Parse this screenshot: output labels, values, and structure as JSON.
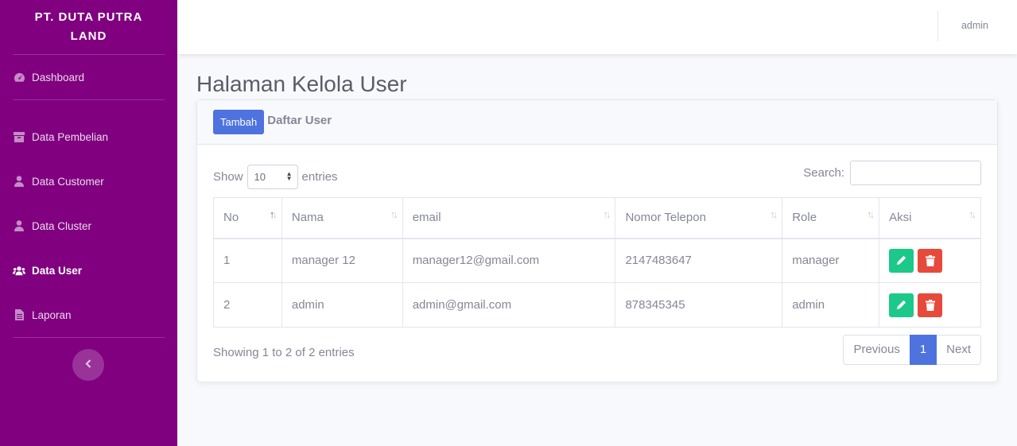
{
  "sidebar": {
    "brand": "PT. DUTA PUTRA LAND",
    "items": [
      {
        "label": "Dashboard",
        "icon": "tachometer-icon"
      },
      {
        "label": "Data Pembelian",
        "icon": "box-icon"
      },
      {
        "label": "Data Customer",
        "icon": "user-icon"
      },
      {
        "label": "Data Cluster",
        "icon": "user-icon"
      },
      {
        "label": "Data User",
        "icon": "users-icon",
        "active": true
      },
      {
        "label": "Laporan",
        "icon": "file-icon"
      }
    ]
  },
  "topbar": {
    "user": "admin"
  },
  "page": {
    "title": "Halaman Kelola User"
  },
  "card": {
    "add_label": "Tambah",
    "title": "Daftar User"
  },
  "controls": {
    "show_label": "Show",
    "entries_value": "10",
    "entries_label": "entries",
    "search_label": "Search:"
  },
  "table": {
    "headers": [
      "No",
      "Nama",
      "email",
      "Nomor Telepon",
      "Role",
      "Aksi"
    ],
    "rows": [
      {
        "no": "1",
        "nama": "manager 12",
        "email": "manager12@gmail.com",
        "telepon": "2147483647",
        "role": "manager"
      },
      {
        "no": "2",
        "nama": "admin",
        "email": "admin@gmail.com",
        "telepon": "878345345",
        "role": "admin"
      }
    ]
  },
  "footer": {
    "info": "Showing 1 to 2 of 2 entries",
    "prev": "Previous",
    "page": "1",
    "next": "Next"
  },
  "colors": {
    "sidebar": "#800080",
    "primary": "#4e73df",
    "success": "#1cc88a",
    "danger": "#e74a3b"
  }
}
